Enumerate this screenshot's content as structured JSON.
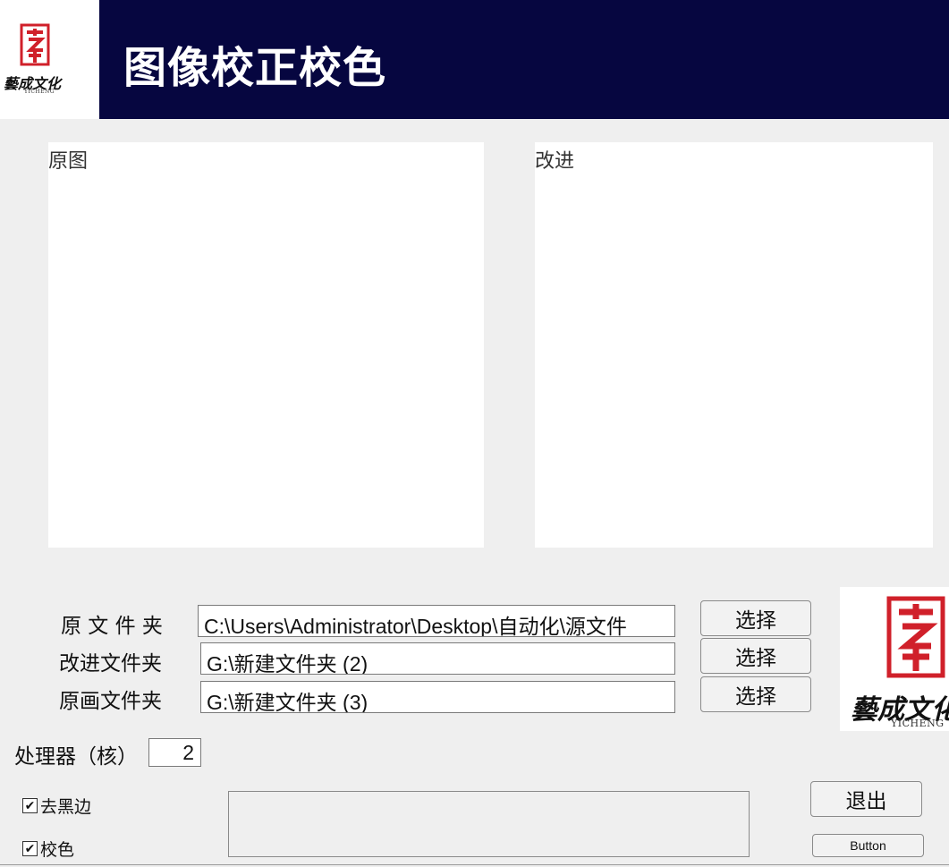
{
  "header": {
    "title": "图像校正校色",
    "logo_text": "藝成文化",
    "logo_sub": "YICHENG",
    "background": "#060640"
  },
  "panels": {
    "original_label": "原图",
    "improved_label": "改进"
  },
  "folders": [
    {
      "label": "原 文 件 夹",
      "value": "C:\\Users\\Administrator\\Desktop\\自动化\\源文件",
      "button": "选择"
    },
    {
      "label": "改进文件夹",
      "value": "G:\\新建文件夹 (2)",
      "button": "选择"
    },
    {
      "label": "原画文件夹",
      "value": "G:\\新建文件夹 (3)",
      "button": "选择"
    }
  ],
  "brand_logo": {
    "text": "藝成文化",
    "sub": "YICHENG",
    "seal_color": "#d0202a"
  },
  "processor": {
    "label": "处理器（核）",
    "value": "2"
  },
  "options": [
    {
      "label": "去黑边",
      "checked": true
    },
    {
      "label": "校色",
      "checked": true
    }
  ],
  "buttons": {
    "exit": "退出",
    "generic": "Button"
  }
}
